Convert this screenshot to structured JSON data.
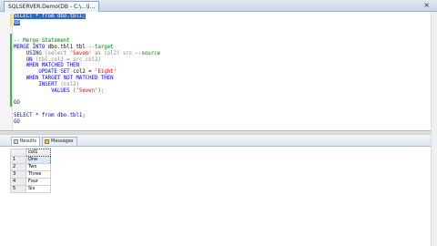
{
  "window": {
    "tab_title": "SQLSERVER.Demo(DB - C:\\...\\l...",
    "close_glyph": "×"
  },
  "editor": {
    "lines": [
      [
        {
          "t": "SELECT * from dbo.tbl1;",
          "c": "sel"
        }
      ],
      [
        {
          "t": "GO",
          "c": "sel"
        }
      ],
      [
        {
          "t": "",
          "c": "txt"
        }
      ],
      [
        {
          "t": "",
          "c": "txt"
        }
      ],
      [
        {
          "t": "-- Merge Statement",
          "c": "cm"
        }
      ],
      [
        {
          "t": "MERGE INTO ",
          "c": "kw"
        },
        {
          "t": "dbo.tbl1 tbl ",
          "c": "txt"
        },
        {
          "t": "--target",
          "c": "cm"
        }
      ],
      [
        {
          "t": "    USING ",
          "c": "kw"
        },
        {
          "t": "(select ",
          "c": "gr"
        },
        {
          "t": "'Seven'",
          "c": "str"
        },
        {
          "t": " as col2) src ",
          "c": "gr"
        },
        {
          "t": "--source",
          "c": "cm"
        }
      ],
      [
        {
          "t": "    ON ",
          "c": "kw"
        },
        {
          "t": "(tbl.col2 = src.col2)",
          "c": "gr"
        }
      ],
      [
        {
          "t": "    WHEN MATCHED THEN",
          "c": "kw"
        }
      ],
      [
        {
          "t": "        UPDATE SET ",
          "c": "kw"
        },
        {
          "t": "col2 = ",
          "c": "txt"
        },
        {
          "t": "'Eight'",
          "c": "str"
        }
      ],
      [
        {
          "t": "    WHEN TARGET NOT MATCHED THEN",
          "c": "kw"
        }
      ],
      [
        {
          "t": "        INSERT ",
          "c": "kw"
        },
        {
          "t": "(col2)",
          "c": "gr"
        }
      ],
      [
        {
          "t": "            VALUES ",
          "c": "kw"
        },
        {
          "t": "('Seven')",
          "c": "str"
        },
        {
          "t": ";",
          "c": "gr"
        }
      ],
      [
        {
          "t": "",
          "c": "txt"
        }
      ],
      [
        {
          "t": "GO",
          "c": "kw"
        }
      ],
      [
        {
          "t": "",
          "c": "txt"
        }
      ],
      [
        {
          "t": "SELECT * from dbo.tbl1;",
          "c": "kw"
        }
      ],
      [
        {
          "t": "GO",
          "c": "kw"
        }
      ]
    ]
  },
  "results": {
    "tabs": [
      {
        "label": "Results",
        "icon": "grid-icon"
      },
      {
        "label": "Messages",
        "icon": "messages-icon"
      }
    ],
    "columns": [
      "col1"
    ],
    "rows": [
      [
        "1",
        "One"
      ],
      [
        "2",
        "Two"
      ],
      [
        "3",
        "Three"
      ],
      [
        "4",
        "Four"
      ],
      [
        "5",
        "Six"
      ]
    ]
  }
}
